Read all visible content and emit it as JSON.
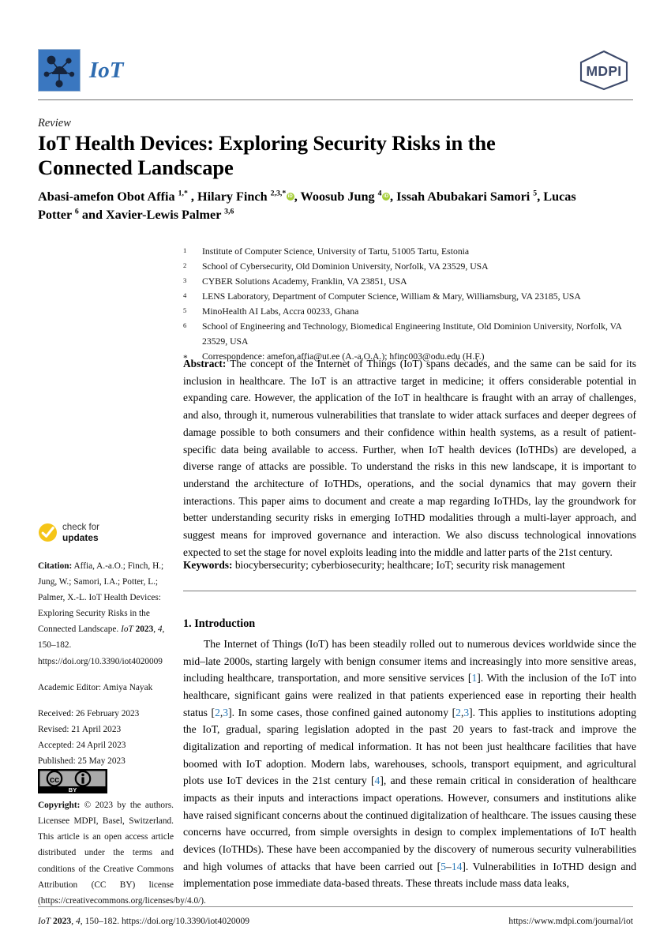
{
  "journal": {
    "logo_text": "IoT",
    "logo_icon": "iot-network-cloud-icon",
    "publisher_logo_text": "MDPI"
  },
  "article": {
    "type": "Review",
    "title": "IoT Health Devices: Exploring Security Risks in the Connected Landscape",
    "authors_html": "Abasi-amefon Obot Affia <sup>1,*</sup> , Hilary Finch <sup>2,3,*</sup><span class=\"orcid\" data-name=\"orcid-icon\"></span>, Woosub Jung <sup>4</sup><span class=\"orcid\" data-name=\"orcid-icon\"></span>, Issah Abubakari Samori <sup>5</sup>, Lucas Potter <sup>6</sup> and Xavier-Lewis Palmer <sup>3,6</sup>"
  },
  "affiliations": [
    {
      "num": "1",
      "text": "Institute of Computer Science, University of Tartu, 51005 Tartu, Estonia"
    },
    {
      "num": "2",
      "text": "School of Cybersecurity, Old Dominion University, Norfolk, VA 23529, USA"
    },
    {
      "num": "3",
      "text": "CYBER Solutions Academy, Franklin, VA 23851, USA"
    },
    {
      "num": "4",
      "text": "LENS Laboratory, Department of Computer Science, William & Mary, Williamsburg, VA 23185, USA"
    },
    {
      "num": "5",
      "text": "MinoHealth AI Labs, Accra 00233, Ghana"
    },
    {
      "num": "6",
      "text": "School of Engineering and Technology, Biomedical Engineering Institute, Old Dominion University, Norfolk, VA 23529, USA"
    },
    {
      "num": "*",
      "text": "Correspondence: amefon.affia@ut.ee (A.-a.O.A.); hfinc003@odu.edu (H.F.)"
    }
  ],
  "abstract": {
    "label": "Abstract:",
    "text": "The concept of the Internet of Things (IoT) spans decades, and the same can be said for its inclusion in healthcare. The IoT is an attractive target in medicine; it offers considerable potential in expanding care. However, the application of the IoT in healthcare is fraught with an array of challenges, and also, through it, numerous vulnerabilities that translate to wider attack surfaces and deeper degrees of damage possible to both consumers and their confidence within health systems, as a result of patient-specific data being available to access. Further, when IoT health devices (IoTHDs) are developed, a diverse range of attacks are possible. To understand the risks in this new landscape, it is important to understand the architecture of IoTHDs, operations, and the social dynamics that may govern their interactions. This paper aims to document and create a map regarding IoTHDs, lay the groundwork for better understanding security risks in emerging IoTHD modalities through a multi-layer approach, and suggest means for improved governance and interaction. We also discuss technological innovations expected to set the stage for novel exploits leading into the middle and latter parts of the 21st century."
  },
  "keywords": {
    "label": "Keywords:",
    "text": "biocybersecurity; cyberbiosecurity; healthcare; IoT; security risk management"
  },
  "sidebar": {
    "check_for_updates": {
      "line1": "check for",
      "line2": "updates",
      "icon": "check-circle-icon"
    },
    "citation_label": "Citation:",
    "citation_html": "<b>Citation:</b> Affia, A.-a.O.; Finch, H.; Jung, W.; Samori, I.A.; Potter, L.; Palmer, X.-L. IoT Health Devices: Exploring Security Risks in the Connected Landscape. <i>IoT</i> <b>2023</b>, <i>4</i>, 150–182. https://doi.org/10.3390/iot4020009",
    "academic_editor": "Academic Editor: Amiya Nayak",
    "dates": [
      "Received: 26 February 2023",
      "Revised: 21 April 2023",
      "Accepted: 24 April 2023",
      "Published: 25 May 2023"
    ],
    "license_badge": {
      "cc": "cc",
      "by": "BY",
      "icon": "creative-commons-by-icon"
    },
    "copyright_html": "<b>Copyright:</b> © 2023 by the authors. Licensee MDPI, Basel, Switzerland. This article is an open access article distributed under the terms and conditions of the Creative Commons Attribution (CC BY) license (https://creativecommons.org/licenses/by/4.0/)."
  },
  "section": {
    "heading": "1. Introduction",
    "paragraph_html": "<span class=\"indent\">The Internet of Things (IoT) has been steadily rolled out to numerous devices worldwide since the mid–late 2000s, starting largely with benign consumer items and increasingly into more sensitive areas, including healthcare, transportation, and more sensitive services [<a class=\"ref\" href=\"#\" data-name=\"citation-link\" data-interactable=\"true\">1</a>]. With the inclusion of the IoT into healthcare, significant gains were realized in that patients experienced ease in reporting their health status [<a class=\"ref\" href=\"#\" data-name=\"citation-link\" data-interactable=\"true\">2</a>,<a class=\"ref\" href=\"#\" data-name=\"citation-link\" data-interactable=\"true\">3</a>]. In some cases, those confined gained autonomy [<a class=\"ref\" href=\"#\" data-name=\"citation-link\" data-interactable=\"true\">2</a>,<a class=\"ref\" href=\"#\" data-name=\"citation-link\" data-interactable=\"true\">3</a>]. This applies to institutions adopting the IoT, gradual, sparing legislation adopted in the past 20 years to fast-track and improve the digitalization and reporting of medical information. It has not been just healthcare facilities that have boomed with IoT adoption. Modern labs, warehouses, schools, transport equipment, and agricultural plots use IoT devices in the 21st century [<a class=\"ref\" href=\"#\" data-name=\"citation-link\" data-interactable=\"true\">4</a>], and these remain critical in consideration of healthcare impacts as their inputs and interactions impact operations. However, consumers and institutions alike have raised significant concerns about the continued digitalization of healthcare. The issues causing these concerns have occurred, from simple oversights in design to complex implementations of IoT health devices (IoTHDs). These have been accompanied by the discovery of numerous security vulnerabilities and high volumes of attacks that have been carried out [<a class=\"ref\" href=\"#\" data-name=\"citation-link\" data-interactable=\"true\">5</a>–<a class=\"ref\" href=\"#\" data-name=\"citation-link\" data-interactable=\"true\">14</a>]. Vulnerabilities in IoTHD design and implementation pose immediate data-based threats. These threats include mass data leaks,</span>"
  },
  "footer": {
    "left_html": "<i>IoT</i> <b>2023</b>, <i>4</i>, 150–182. https://doi.org/10.3390/iot4020009",
    "right": "https://www.mdpi.com/journal/iot"
  },
  "colors": {
    "brand_blue": "#2f6cb0",
    "logo_bg": "#3a77c0",
    "mdpi_navy": "#3d4a6b",
    "link_blue": "#2a7ab9",
    "orcid_green": "#a6ce39",
    "check_yellow": "#f5c518"
  }
}
